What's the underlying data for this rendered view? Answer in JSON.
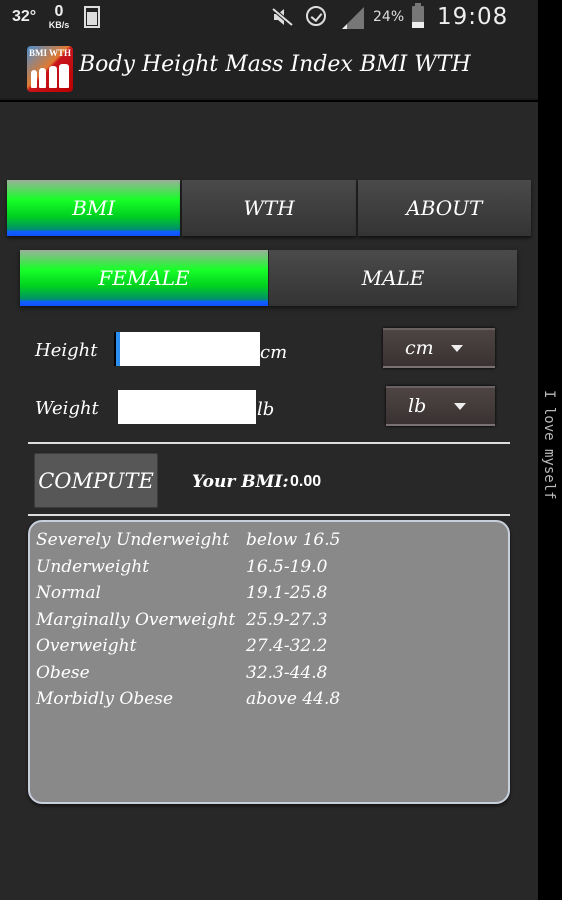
{
  "status_bar": {
    "temperature": "32°",
    "net_speed_value": "0",
    "net_speed_unit": "KB/s",
    "battery_percent": "24%",
    "time": "19:08",
    "icons": [
      "cup-icon",
      "mute-icon",
      "alarm-icon",
      "signal-icon",
      "battery-icon"
    ]
  },
  "app": {
    "icon_label": "BMI WTH",
    "title": "Body Height Mass Index BMI WTH"
  },
  "tabs": [
    {
      "label": "BMI",
      "active": true
    },
    {
      "label": "WTH",
      "active": false
    },
    {
      "label": "ABOUT",
      "active": false
    }
  ],
  "gender": [
    {
      "label": "FEMALE",
      "active": true
    },
    {
      "label": "MALE",
      "active": false
    }
  ],
  "form": {
    "height": {
      "label": "Height",
      "value": "",
      "suffix": "cm",
      "unit_selected": "cm"
    },
    "weight": {
      "label": "Weight",
      "value": "",
      "suffix": "lb",
      "unit_selected": "lb"
    }
  },
  "compute": {
    "button_label": "COMPUTE",
    "result_label": "Your BMI:",
    "result_value": "0.00"
  },
  "bmi_table": [
    {
      "category": "Severely Underweight",
      "range": "below 16.5"
    },
    {
      "category": "Underweight",
      "range": "16.5-19.0"
    },
    {
      "category": "Normal",
      "range": "19.1-25.8"
    },
    {
      "category": "Marginally Overweight",
      "range": "25.9-27.3"
    },
    {
      "category": "Overweight",
      "range": "27.4-32.2"
    },
    {
      "category": "Obese",
      "range": "32.3-44.8"
    },
    {
      "category": "Morbidly Obese",
      "range": "above 44.8"
    }
  ],
  "side_text": "I love myself",
  "colors": {
    "active_gradient_top": "#18ff28",
    "active_gradient_bottom": "#1050ff",
    "background": "#282828",
    "table_bg": "#898989"
  }
}
